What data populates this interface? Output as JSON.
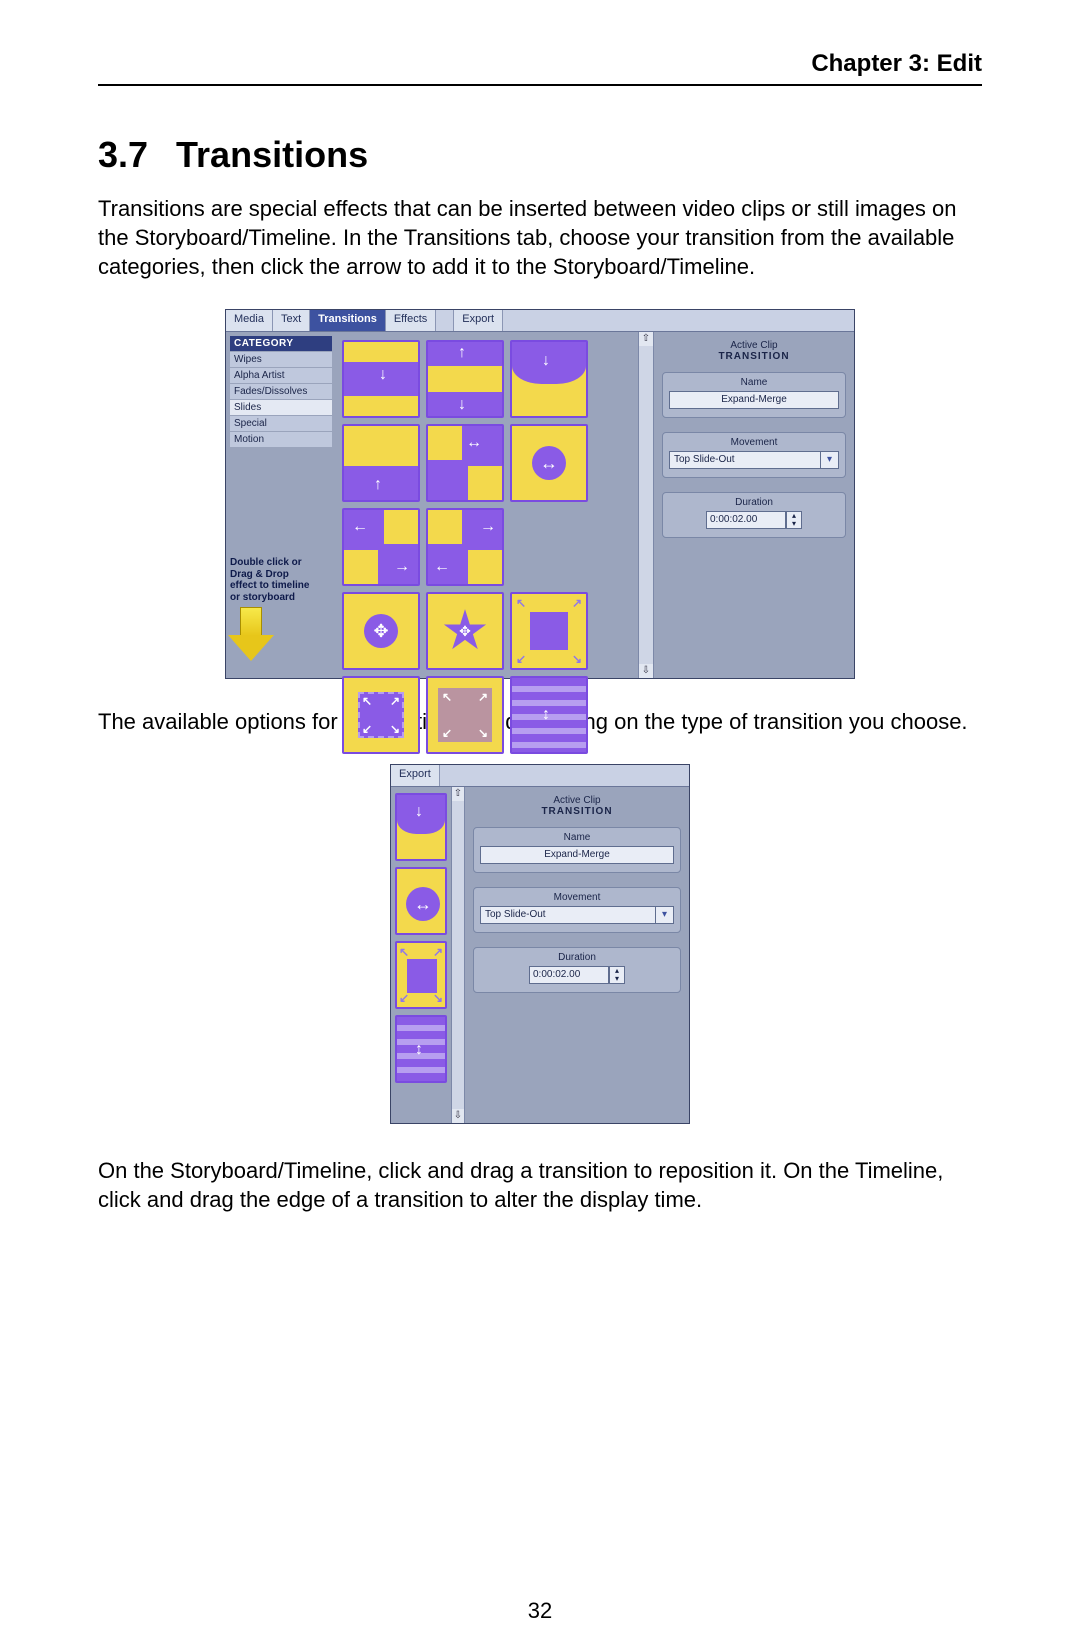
{
  "header": {
    "chapter": "Chapter 3:  Edit"
  },
  "section": {
    "num": "3.7",
    "title": "Transitions"
  },
  "para1": "Transitions are special effects that can be inserted between video clips or still images on the Storyboard/Timeline. In the Transitions tab, choose your transition from the available categories, then click the arrow to add it to the Storyboard/Timeline.",
  "para2": "The available options for a transition vary depending on the type of transition you choose.",
  "para3": "On the Storyboard/Timeline, click and drag a transition to reposition it. On the Timeline, click and drag the edge of a transition to alter the display time.",
  "page": "32",
  "tabs": {
    "media": "Media",
    "text": "Text",
    "transitions": "Transitions",
    "effects": "Effects",
    "export": "Export"
  },
  "category": {
    "header": "CATEGORY",
    "items": [
      "Wipes",
      "Alpha Artist",
      "Fades/Dissolves",
      "Slides",
      "Special",
      "Motion"
    ],
    "selected": "Slides"
  },
  "hint": {
    "l1": "Double click or",
    "l2": "Drag & Drop",
    "l3": "effect to timeline",
    "l4": "or storyboard"
  },
  "settings": {
    "activeClip": "Active Clip",
    "transition": "TRANSITION",
    "nameLabel": "Name",
    "nameValue": "Expand-Merge",
    "movementLabel": "Movement",
    "movementValue": "Top Slide-Out",
    "durationLabel": "Duration",
    "durationValue": "0:00:02.00"
  },
  "scroll": {
    "up": "⇧",
    "down": "⇩"
  }
}
